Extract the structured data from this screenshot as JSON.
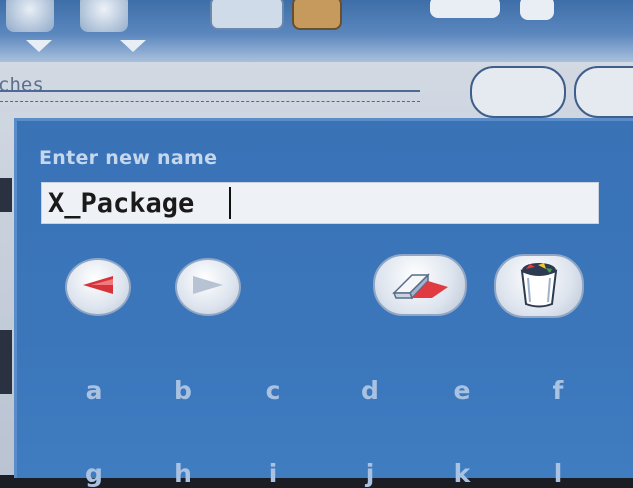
{
  "background": {
    "panel_label": "ches"
  },
  "dialog": {
    "title": "Enter new name",
    "name_value": "X_Package",
    "keys_row1": [
      "a",
      "b",
      "c",
      "d",
      "e",
      "f"
    ],
    "keys_row2": [
      "g",
      "h",
      "i",
      "j",
      "k",
      "l"
    ]
  },
  "icons": {
    "prev": "left-arrow-icon",
    "next": "right-arrow-icon",
    "erase": "eraser-icon",
    "delete": "trash-bin-icon"
  },
  "colors": {
    "dialog_bg": "#3b76bb",
    "title_text": "#c5d7ec",
    "key_text": "#a9c2e2",
    "arrow_active": "#d6343a",
    "arrow_disabled": "#b7c3d3"
  }
}
